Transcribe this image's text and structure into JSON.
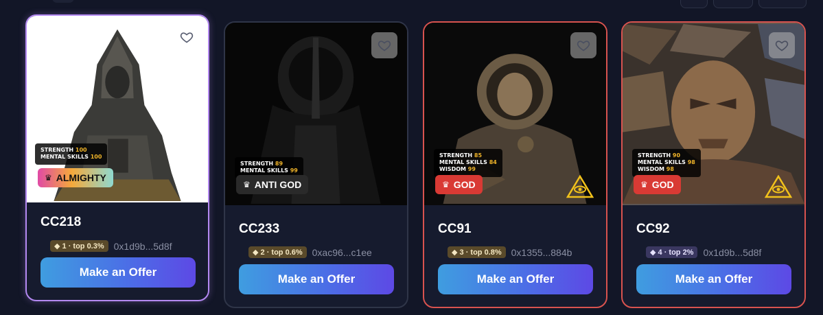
{
  "cards": [
    {
      "id": "CC218",
      "stats": {
        "strength_label": "STRENGTH",
        "strength": "100",
        "mental_label": "MENTAL SKILLS",
        "mental": "100"
      },
      "tier": "ALMIGHTY",
      "rank_text": "◆ 1 · top 0.3%",
      "address": "0x1d9b...5d8f",
      "offer_label": "Make an Offer",
      "border_color": "#b489f2"
    },
    {
      "id": "CC233",
      "stats": {
        "strength_label": "STRENGTH",
        "strength": "89",
        "mental_label": "MENTAL SKILLS",
        "mental": "99"
      },
      "tier": "ANTI GOD",
      "rank_text": "◆ 2 · top 0.6%",
      "address": "0xac96...c1ee",
      "offer_label": "Make an Offer",
      "border_color": "#2f3548"
    },
    {
      "id": "CC91",
      "stats": {
        "strength_label": "STRENGTH",
        "strength": "85",
        "mental_label": "MENTAL SKILLS",
        "mental": "84",
        "wisdom_label": "WISDOM",
        "wisdom": "99"
      },
      "tier": "GOD",
      "rank_text": "◆ 3 · top 0.8%",
      "address": "0x1355...884b",
      "offer_label": "Make an Offer",
      "border_color": "#d9534f"
    },
    {
      "id": "CC92",
      "stats": {
        "strength_label": "STRENGTH",
        "strength": "90",
        "mental_label": "MENTAL SKILLS",
        "mental": "98",
        "wisdom_label": "WISDOM",
        "wisdom": "98"
      },
      "tier": "GOD",
      "rank_text": "◆ 4 · top 2%",
      "address": "0x1d9b...5d8f",
      "offer_label": "Make an Offer",
      "border_color": "#d9534f"
    }
  ],
  "icons": {
    "favorite": "heart-outline-icon",
    "tier": "crown-icon",
    "eye": "all-seeing-eye-icon"
  },
  "colors": {
    "accent_gradient_start": "#3f9de0",
    "accent_gradient_end": "#5d49e5",
    "background": "#121627",
    "stat_value": "#f0b429"
  }
}
